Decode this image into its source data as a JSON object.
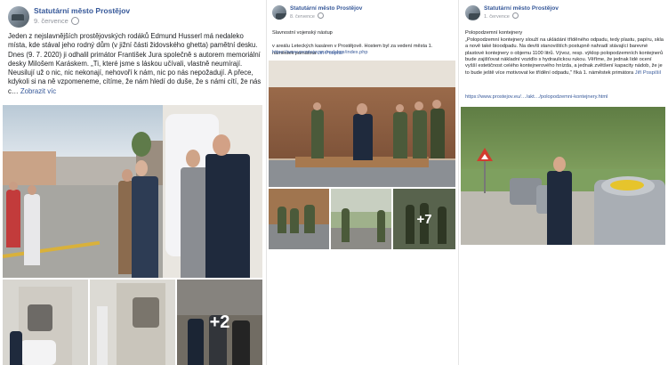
{
  "posts": [
    {
      "page_name": "Statutární město Prostějov",
      "date": "9. července",
      "text_part1": "Jeden z nejslavnějších prostějovských rodáků Edmund Husserl má nedaleko místa, kde stával jeho rodný dům (v jižní části židovského ghetta) pamětní desku. Dnes (9. 7. 2020) ji odhalil primátor František Jura společně s autorem memoriální desky Milošem Karáskem. „Ti, které jsme s láskou učívali, vlastně neumírají. Neusilují už o nic, nic nekonají, nehovoří k nám, nic po nás nepožadují. A přece, kdykoli si na ně vzpomeneme, cítíme, že nám hledí do duše, že s námi cítí, že nás c…",
      "see_more": "Zobrazit víc",
      "more_photos": "+2"
    },
    {
      "page_name": "Statutární město Prostějov",
      "date": "8. července",
      "text_part1": "Slavnostní vojenský nástup\n\nv areálu Leteckých kasáren v Prostějově. Hostem byl za vedení města 1. náměstek primátora ",
      "mention": "Jiří Pospíšil",
      "url": "https://www.prostejov.eu/redakce/index.php",
      "more_photos": "+7"
    },
    {
      "page_name": "Statutární město Prostějov",
      "date": "1. července",
      "text_part1": "Polopodzemní kontejnery\n„Polopodzemní kontejnery slouží na ukládání tříděného odpadu, tedy plastu, papíru, skla a nově také bioodpadu. Na devíti stanovištích postupně nahradí stávající barevné plastové kontejnery o objemu 1100 litrů. Vývoz, resp. výklop polopodzemních kontejnerů bude zajišťovat nákladní vozidlo s hydraulickou rukou. Věříme, že jednak lidé ocení vyšší estetičnost celého kontejnerového hnízda, a jednak zvětšení kapacity nádob, že je to bude ještě více motivovat ke třídění odpadu,\" říká 1. náměstek primátora ",
      "mention": "Jiří Pospíšil",
      "url": "https://www.prostejov.eu/…/akt…/polopodzemni-kontejnery.html"
    }
  ],
  "colors": {
    "link": "#365899",
    "meta": "#90949c",
    "text": "#1c1e21"
  }
}
